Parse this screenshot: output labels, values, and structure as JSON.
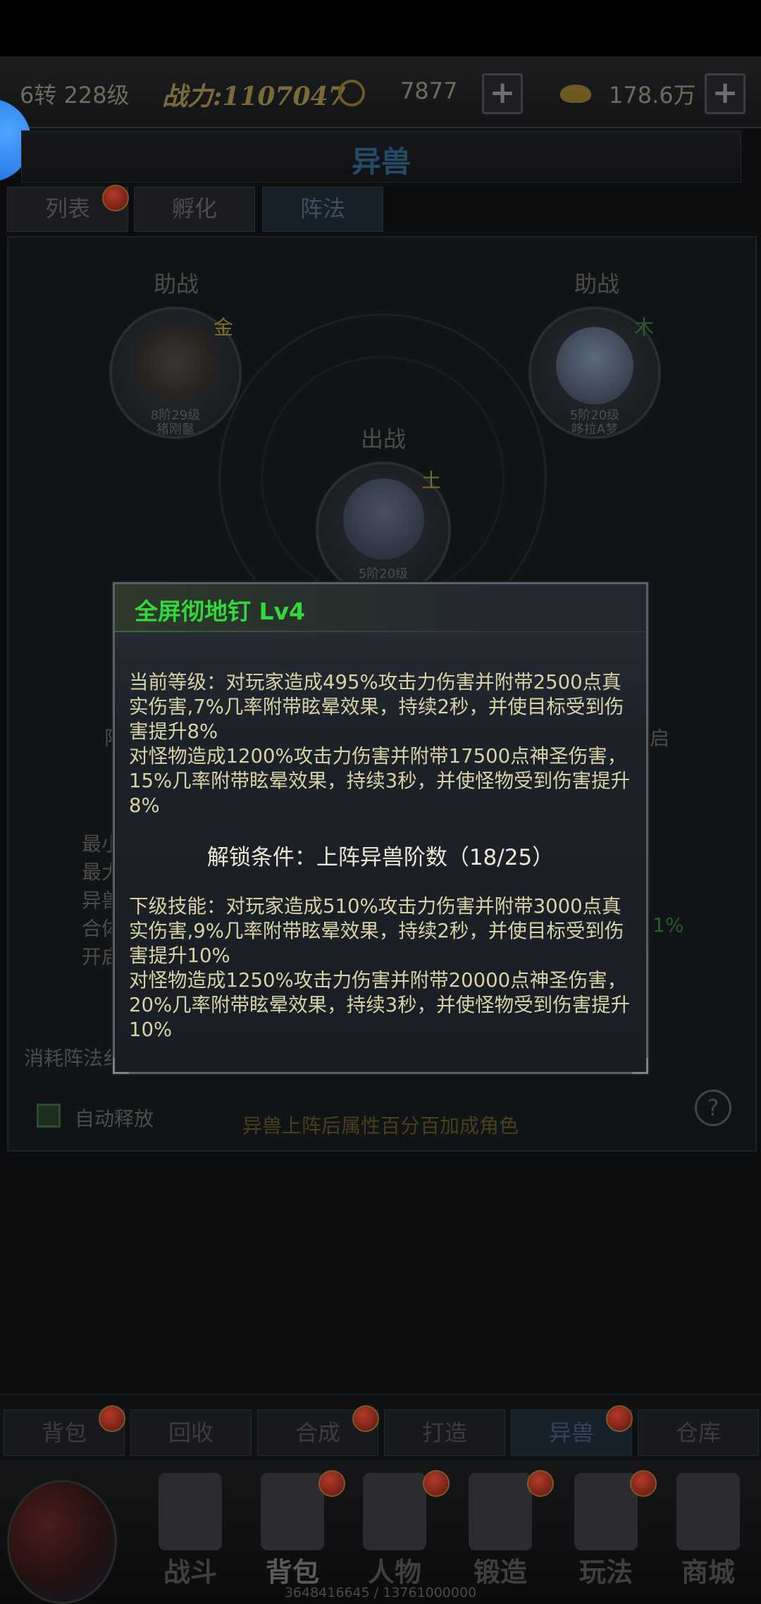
{
  "topbar": {
    "level": "6转 228级",
    "power": "战力:1107047",
    "coins": "7877",
    "gold": "178.6万",
    "plus": "+"
  },
  "title": "异兽",
  "tabs": [
    {
      "label": "列表",
      "has_dot": true
    },
    {
      "label": "孵化",
      "has_dot": false
    },
    {
      "label": "阵法",
      "has_dot": false,
      "active": true
    }
  ],
  "formation": {
    "support_label": "助战",
    "battle_label": "出战",
    "left_pet": {
      "stage": "8阶29级",
      "name": "猪刚鬣",
      "element": "金"
    },
    "right_pet": {
      "stage": "5阶20级",
      "name": "哆拉A梦",
      "element": "木"
    },
    "center_pet": {
      "stage": "5阶20级",
      "element": "土"
    }
  },
  "behind_popup": {
    "left_frag": "阵",
    "right_frag": "启",
    "stat_frags": [
      "最小",
      "最大",
      "异兽",
      "合体",
      "开启"
    ],
    "pct_frag": "1%",
    "consume_label": "消耗阵法纟"
  },
  "popup": {
    "title": "全屏彻地钉  Lv4",
    "current": "当前等级：对玩家造成495%攻击力伤害并附带2500点真实伤害,7%几率附带眩晕效果，持续2秒，并使目标受到伤害提升8%\n对怪物造成1200%攻击力伤害并附带17500点神圣伤害，15%几率附带眩晕效果，持续3秒，并使怪物受到伤害提升8%",
    "unlock": "解锁条件：上阵异兽阶数（18/25）",
    "next": "下级技能：对玩家造成510%攻击力伤害并附带3000点真实伤害,9%几率附带眩晕效果，持续2秒，并使目标受到伤害提升10%\n对怪物造成1250%攻击力伤害并附带20000点神圣伤害，20%几率附带眩晕效果，持续3秒，并使怪物受到伤害提升10%"
  },
  "auto_release": "自动释放",
  "hint": "异兽上阵后属性百分百加成角色",
  "help": "?",
  "subtabs": [
    {
      "label": "背包",
      "dot": true
    },
    {
      "label": "回收",
      "dot": false
    },
    {
      "label": "合成",
      "dot": true
    },
    {
      "label": "打造",
      "dot": false
    },
    {
      "label": "异兽",
      "dot": true,
      "active": true
    },
    {
      "label": "仓库",
      "dot": false
    }
  ],
  "nav": [
    {
      "label": "战斗",
      "dot": false
    },
    {
      "label": "背包",
      "dot": true
    },
    {
      "label": "人物",
      "dot": true
    },
    {
      "label": "锻造",
      "dot": true
    },
    {
      "label": "玩法",
      "dot": true
    },
    {
      "label": "商城",
      "dot": false
    }
  ],
  "exp": "3648416645 / 13761000000",
  "colors": {
    "popup_title": "#33d83a",
    "popup_text": "#d8d2a8",
    "background": "#0b0d0f"
  }
}
